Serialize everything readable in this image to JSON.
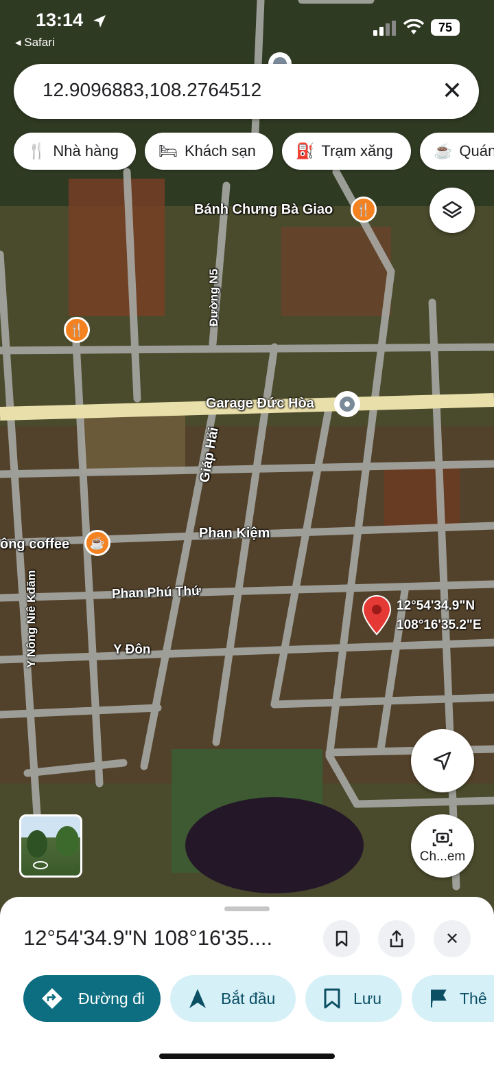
{
  "status_bar": {
    "time": "13:14",
    "back_app": "◂ Safari",
    "battery": "75"
  },
  "search": {
    "query": "12.9096883,108.2764512"
  },
  "categories": [
    {
      "label": "Nhà hàng",
      "icon": "restaurant-icon"
    },
    {
      "label": "Khách sạn",
      "icon": "hotel-icon"
    },
    {
      "label": "Trạm xăng",
      "icon": "gas-station-icon"
    },
    {
      "label": "Quán",
      "icon": "cafe-icon"
    }
  ],
  "map": {
    "places": {
      "banh_chung": "Bánh Chưng Bà Giao",
      "garage": "Garage Đức Hòa",
      "coffee": "ông coffee"
    },
    "streets": {
      "duong_n5": "Đường N5",
      "giap_hai": "Giáp Hải",
      "phan_kiem": "Phan Kiệm",
      "phan_phu_thu": "Phan Phú Thứ",
      "y_don": "Y Đôn",
      "y_nong": "Y Nông Niê Kđăm"
    },
    "pin": {
      "lat": "12°54'34.9\"N",
      "lng": "108°16'35.2\"E"
    },
    "camera_label": "Ch...em",
    "marker_color": "#e53935",
    "poi_color": "#f58220"
  },
  "sheet": {
    "title": "12°54'34.9\"N 108°16'35....",
    "actions": [
      {
        "label": "Đường đi",
        "icon": "directions-icon"
      },
      {
        "label": "Bắt đầu",
        "icon": "navigation-icon"
      },
      {
        "label": "Lưu",
        "icon": "bookmark-icon"
      },
      {
        "label": "Thê",
        "icon": "flag-icon"
      }
    ]
  }
}
